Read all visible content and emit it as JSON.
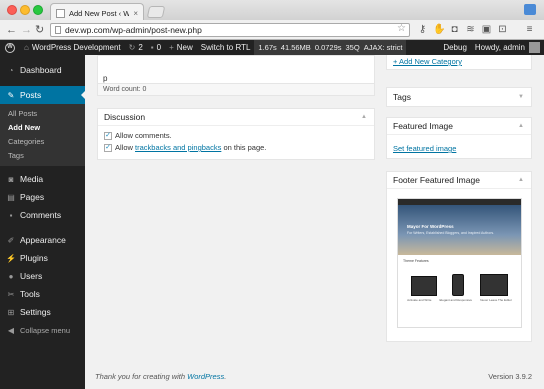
{
  "browser": {
    "tab_title": "Add New Post ‹ WordPress",
    "tab_close": "×",
    "url": "dev.wp.com/wp-admin/post-new.php",
    "back_glyph": "←",
    "forward_glyph": "→",
    "reload_glyph": "↻",
    "star_glyph": "☆",
    "extensions": [
      "key-icon",
      "hand-icon",
      "pocket-icon",
      "buffer-icon",
      "clipboard-icon",
      "tab-icon",
      "menu-icon"
    ],
    "extension_glyphs": [
      "⚷",
      "✋",
      "◘",
      "≋",
      "▣",
      "⊡",
      "≡"
    ]
  },
  "adminbar": {
    "wp_glyph": "W",
    "site_name": "WordPress Development",
    "updates_count": "2",
    "comments_count": "0",
    "new_label": "New",
    "rtl_label": "Switch to RTL",
    "qm_time": "1.67s",
    "qm_memory": "41.56MB",
    "qm_query_time": "0.0729s",
    "qm_queries": "35Q",
    "qm_ajax": "AJAX: strict",
    "debug_label": "Debug",
    "howdy": "Howdy, admin"
  },
  "sidebar": {
    "dashboard": "Dashboard",
    "posts": "Posts",
    "posts_submenu": [
      "All Posts",
      "Add New",
      "Categories",
      "Tags"
    ],
    "media": "Media",
    "pages": "Pages",
    "comments": "Comments",
    "appearance": "Appearance",
    "plugins": "Plugins",
    "users": "Users",
    "tools": "Tools",
    "settings": "Settings",
    "collapse": "Collapse menu"
  },
  "editor": {
    "paragraph_tag": "p",
    "word_count": "Word count: 0"
  },
  "discussion": {
    "title": "Discussion",
    "allow_comments": "Allow comments.",
    "allow_prefix": "Allow",
    "trackbacks_link": "trackbacks and pingbacks",
    "allow_suffix": "on this page."
  },
  "right_column": {
    "add_category": "+ Add New Category",
    "tags_title": "Tags",
    "featured_title": "Featured Image",
    "featured_link": "Set featured image",
    "footer_featured_title": "Footer Featured Image",
    "thumb_title": "Mayor For WordPress",
    "thumb_subtitle": "For Writers, Established Bloggers, and Inspired Authors.",
    "thumb_features": "Theme Features",
    "thumb_captions": [
      "Activate and Write",
      "Elegant and Responsive",
      "Never Leave The Editor"
    ]
  },
  "footer": {
    "thanks_prefix": "Thank you for creating with",
    "thanks_link": "WordPress",
    "thanks_suffix": ".",
    "version": "Version 3.9.2"
  }
}
